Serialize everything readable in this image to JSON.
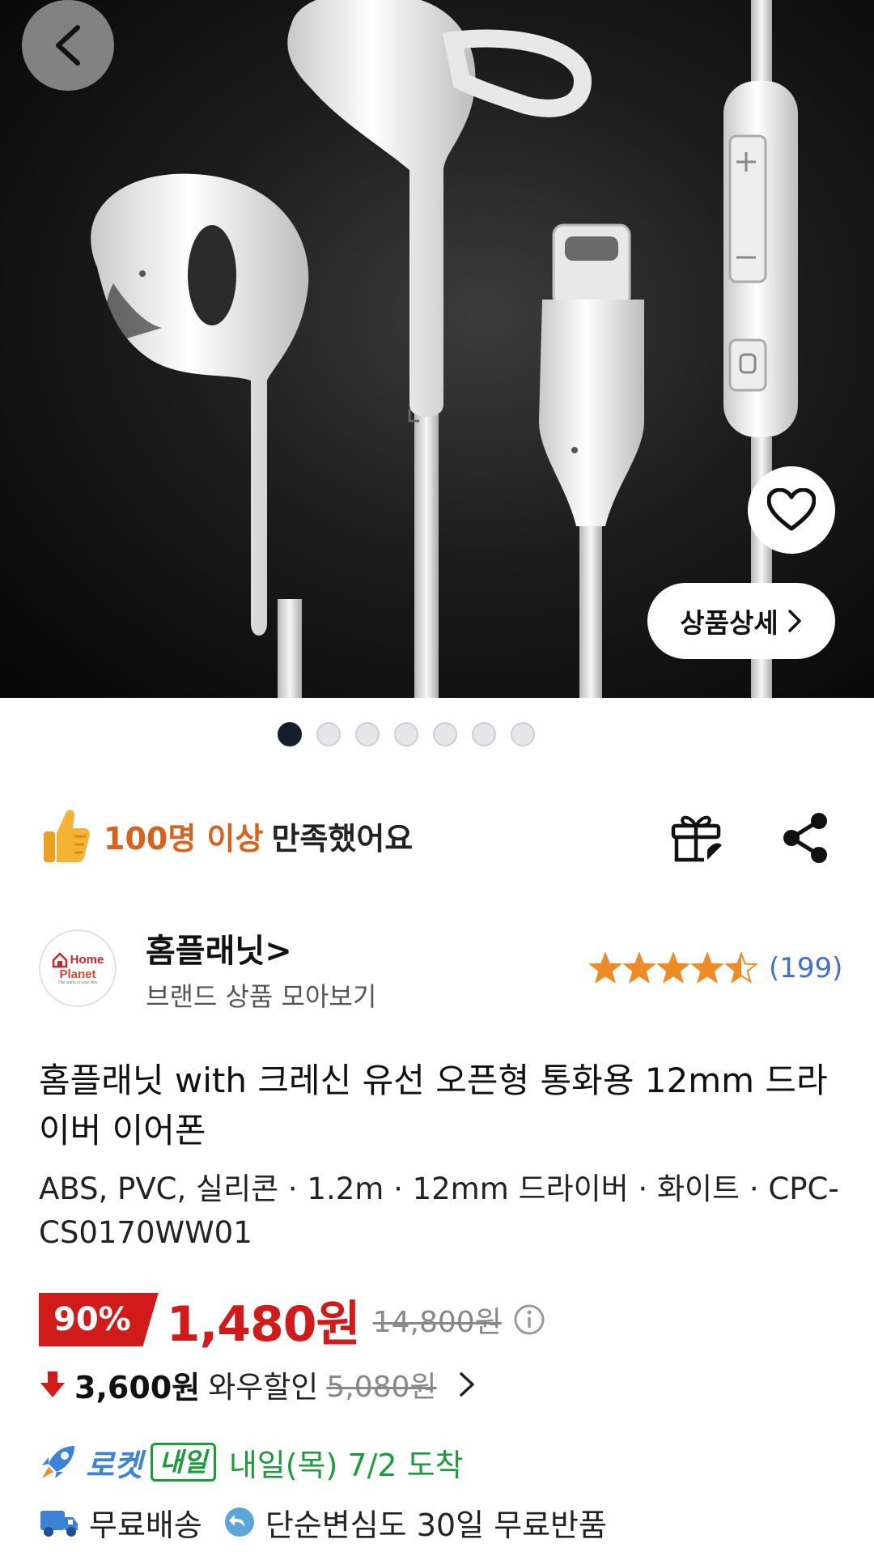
{
  "hero": {
    "detail_button_label": "상품상세",
    "image_count": 7,
    "active_image": 1
  },
  "satisfaction": {
    "highlight": "100명 이상",
    "text": "만족했어요"
  },
  "brand": {
    "name": "홈플래닛>",
    "sub_link": "브랜드 상품 모아보기",
    "logo_text_1": "Home",
    "logo_text_2": "Planet",
    "logo_tagline": "The starts in your lifey",
    "rating_stars": 4.5,
    "review_count": "(199)"
  },
  "product": {
    "title": "홈플래닛 with 크레신 유선 오픈형 통화용 12mm 드라이버 이어폰",
    "specs": "ABS, PVC, 실리콘 · 1.2m · 12mm 드라이버 · 화이트 · CPC-CS0170WW01"
  },
  "price": {
    "discount": "90%",
    "sale_price": "1,480원",
    "original_price": "14,800원",
    "wow_price": "3,600원",
    "wow_label": "와우할인",
    "wow_original": "5,080원"
  },
  "delivery": {
    "rocket_label": "로켓",
    "tomorrow_badge": "내일",
    "arrival": "내일(목) 7/2 도착",
    "free_shipping": "무료배송",
    "free_return": "단순변심도 30일 무료반품"
  },
  "colors": {
    "price_red": "#d11b1b",
    "satisfaction_orange": "#d9621a",
    "rating_blue": "#3d6fd6",
    "rocket_blue": "#3c82d6",
    "delivery_green": "#1a9c3a",
    "star_orange": "#f08a24"
  }
}
